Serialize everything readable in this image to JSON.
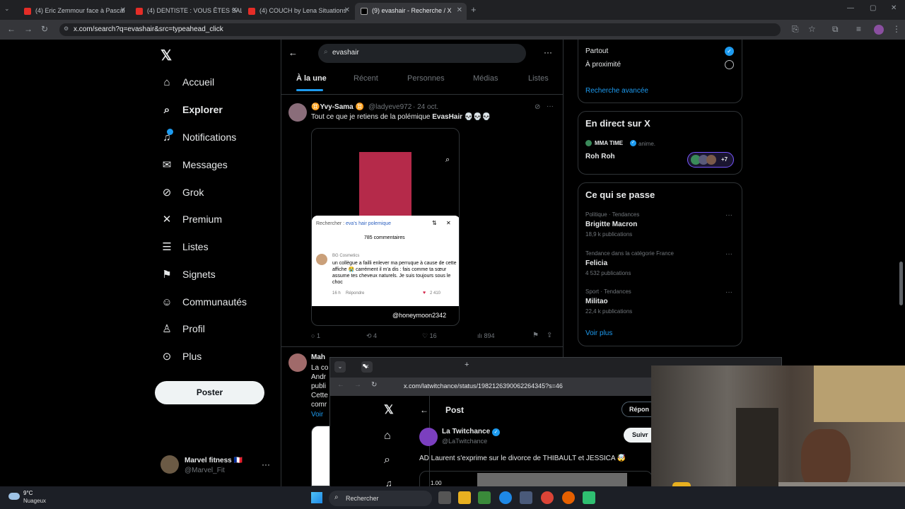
{
  "browser": {
    "tabs": [
      {
        "title": "(4) Eric Zemmour face à Pascal"
      },
      {
        "title": "(4) DENTISTE : VOUS ÊTES SAL"
      },
      {
        "title": "(4) COUCH by Lena Situations"
      },
      {
        "title": "(9) evashair - Recherche / X"
      }
    ],
    "url": "x.com/search?q=evashair&src=typeahead_click"
  },
  "sidebar": {
    "items": [
      {
        "label": "Accueil",
        "icon": "home-icon"
      },
      {
        "label": "Explorer",
        "icon": "search-icon"
      },
      {
        "label": "Notifications",
        "icon": "bell-icon"
      },
      {
        "label": "Messages",
        "icon": "mail-icon"
      },
      {
        "label": "Grok",
        "icon": "grok-icon"
      },
      {
        "label": "Premium",
        "icon": "x-icon"
      },
      {
        "label": "Listes",
        "icon": "list-icon"
      },
      {
        "label": "Signets",
        "icon": "bookmark-icon"
      },
      {
        "label": "Communautés",
        "icon": "people-icon"
      },
      {
        "label": "Profil",
        "icon": "person-icon"
      },
      {
        "label": "Plus",
        "icon": "more-icon"
      }
    ],
    "post_label": "Poster",
    "account": {
      "name": "Marvel fitness 🇫🇷",
      "handle": "@Marvel_Fit"
    }
  },
  "search": {
    "query": "evashair",
    "tabs": [
      "À la une",
      "Récent",
      "Personnes",
      "Médias",
      "Listes"
    ]
  },
  "tweet": {
    "name": "♊Yvy-Sama ♊",
    "handle": "@ladyeve972",
    "date": "· 24 oct.",
    "text_prefix": "Tout ce que je retiens de la polémique ",
    "text_bold": "EvasHair",
    "text_suffix": " 💀💀💀",
    "media": {
      "search_label": "Rechercher : ",
      "search_term": "eva's hair polemique",
      "comments_count": "785 commentaires",
      "commenter": "BG Cosmetics",
      "comment": "un collègue a failli enlever ma perruque à cause de cette affiche 😭 carrément il m'a dis : fais comme ta sœur assume tes cheveux naturels. Je suis toujours sous le choc",
      "comment_time": "16 h",
      "reply_label": "Répondre",
      "likes": "2 410",
      "watermark": "@honeymoon2342"
    },
    "stats": {
      "replies": "1",
      "reposts": "4",
      "likes": "16",
      "views": "894"
    }
  },
  "tweet2": {
    "name": "Mah",
    "lines": [
      "La co",
      "Andr",
      "publi",
      "Cette",
      "comr",
      "Voir"
    ]
  },
  "right": {
    "location": {
      "everywhere": "Partout",
      "nearby": "À proximité",
      "advanced": "Recherche avancée"
    },
    "live": {
      "title": "En direct sur X",
      "host": "MMA TIME",
      "host_action": "anime.",
      "space": "Roh Roh",
      "listeners": "+7"
    },
    "trends": {
      "title": "Ce qui se passe",
      "items": [
        {
          "category": "Politique · Tendances",
          "name": "Brigitte Macron",
          "count": "18,9 k publications"
        },
        {
          "category": "Tendance dans la catégorie France",
          "name": "Felicia",
          "count": "4 532 publications"
        },
        {
          "category": "Sport · Tendances",
          "name": "Militao",
          "count": "22,4 k publications"
        }
      ],
      "see_more": "Voir plus"
    }
  },
  "popup": {
    "url": "x.com/latwitchance/status/1982126390062264345?s=46",
    "header": "Post",
    "reply_btn": "Répon",
    "follow_btn": "Suivr",
    "author": "La Twitchance",
    "handle": "@LaTwitchance",
    "text": "AD Laurent s'exprime sur le divorce de THIBAULT et JESSICA 🤯",
    "video_label": "1.00"
  },
  "taskbar": {
    "weather_temp": "9°C",
    "weather_desc": "Nuageux",
    "search_label": "Rechercher"
  },
  "colors": {
    "accent": "#1d9bf0",
    "background": "#000000"
  }
}
